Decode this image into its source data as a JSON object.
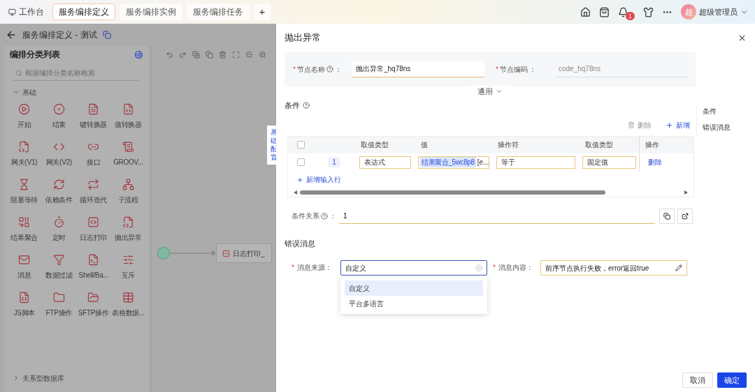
{
  "top_tabs": [
    {
      "label": "工作台",
      "kind": "home",
      "selected": false
    },
    {
      "label": "服务编排定义",
      "kind": "tab",
      "selected": true
    },
    {
      "label": "服务编排实例",
      "kind": "tab",
      "selected": false
    },
    {
      "label": "服务编排任务",
      "kind": "tab",
      "selected": false
    },
    {
      "label": "+",
      "kind": "add",
      "selected": false
    }
  ],
  "notification_badge": "1",
  "user": {
    "avatar": "超",
    "name": "超级管理员"
  },
  "page_title": "服务编排定义 - 测试",
  "sidebar": {
    "title": "编排分类列表",
    "search_placeholder": "根据编排分类名称检索",
    "groups": [
      {
        "label": "基础",
        "expanded": true,
        "items": [
          "开始",
          "结束",
          "键转换器",
          "值转换器",
          "网关(V1)",
          "网关(V2)",
          "接口",
          "GROOV...",
          "阻塞等待",
          "依赖条件",
          "循环迭代",
          "子流程",
          "结果聚合",
          "定时",
          "日志打印",
          "抛出异常",
          "消息",
          "数据过滤",
          "Shell/Ba...",
          "互斥",
          "JS脚本",
          "FTP操作",
          "SFTP操作",
          "表格数据..."
        ]
      },
      {
        "label": "关系型数据库",
        "expanded": false
      }
    ]
  },
  "canvas": {
    "node_label": "日志打印_",
    "side_tab": "基础配置"
  },
  "drawer": {
    "title": "抛出异常",
    "fields": [
      {
        "required_mark": "*",
        "label": "节点名称",
        "help": true,
        "colon": "：",
        "value": "抛出异常_hq78ns",
        "disabled": false
      },
      {
        "required_mark": "*",
        "label": "节点编码",
        "help": false,
        "colon": "：",
        "value": "code_hq78ns",
        "disabled": true
      }
    ],
    "collapse_toggle": "通用",
    "anchors": [
      {
        "label": "条件",
        "selected": false
      },
      {
        "label": "错误消息",
        "selected": false
      }
    ],
    "conditions": {
      "title": "条件",
      "delete_button": "删除",
      "add_button": "新增",
      "columns": [
        "取值类型",
        "值",
        "操作符",
        "取值类型",
        "操作"
      ],
      "rows": [
        {
          "checked": false,
          "index": "1",
          "value_type": "表达式",
          "value_tag": "结果聚合_5wc8p8",
          "value_rest": "[e...",
          "operator": "等于",
          "value_type_2": "固定值",
          "action": "删除"
        }
      ],
      "header_checked": false,
      "add_row": "新增输入行",
      "relation_label": "条件关系",
      "relation_colon": "：",
      "relation_value": "1"
    },
    "error_message": {
      "title": "错误消息",
      "required_mark": "*",
      "source_label": "消息来源：",
      "source_value": "自定义",
      "source_options": [
        {
          "label": "自定义",
          "selected": true
        },
        {
          "label": "平台多语言",
          "selected": false
        }
      ],
      "content_required_mark": "*",
      "content_label": "消息内容：",
      "content_value": "前序节点执行失败，error返回true"
    },
    "buttons": [
      {
        "label": "取消",
        "kind": "secondary"
      },
      {
        "label": "确定",
        "kind": "primary"
      }
    ]
  }
}
